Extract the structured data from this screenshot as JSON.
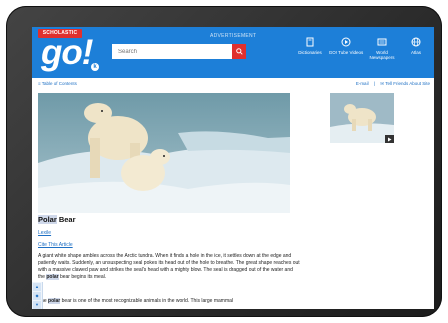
{
  "header": {
    "brand_badge": "SCHOLASTIC",
    "logo": "go!",
    "logo_mark": "k",
    "ad_label": "ADVERTISEMENT",
    "search": {
      "placeholder": "Search"
    },
    "nav": [
      {
        "label": "Dictionaries",
        "icon": "dictionary-icon"
      },
      {
        "label": "GO! Tube Videos",
        "icon": "video-icon"
      },
      {
        "label": "World Newspapers",
        "icon": "newspaper-icon"
      },
      {
        "label": "Atlas",
        "icon": "globe-icon"
      }
    ]
  },
  "subbar": {
    "toc": "≡ Table of Contents",
    "email": "E-mail",
    "separator": "|",
    "tell": "✉ Tell Friends About Site"
  },
  "article": {
    "title_highlight": "Polar",
    "title_rest": " Bear",
    "level": "Lexile",
    "cite": "Cite This Article",
    "para1_a": "A giant white shape ambles across the Arctic tundra. When it finds a hole in the ice, it settles down at the edge and patiently waits. Suddenly, an unsuspecting seal pokes its head out of the hole to breathe. The great shape reaches out with a massive clawed paw and strikes the seal's head with a mighty blow. The seal is dragged out of the water and the ",
    "para1_hl": "polar",
    "para1_b": " bear begins its meal.",
    "para2_a": "The ",
    "para2_hl": "polar",
    "para2_b": " bear is one of the most recognizable animals in the world. This large mammal"
  }
}
